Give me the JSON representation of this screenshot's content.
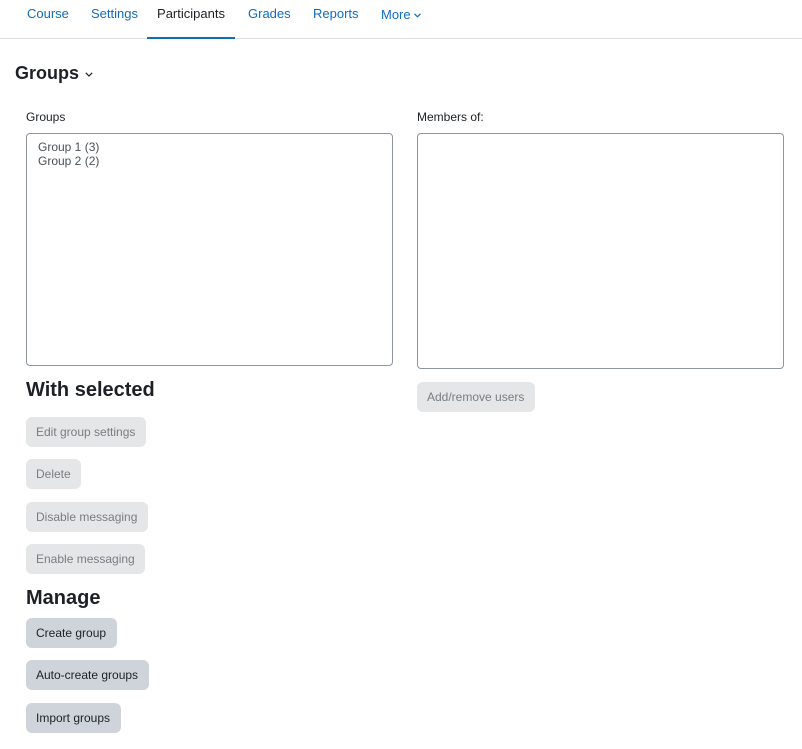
{
  "nav": {
    "tabs": [
      {
        "label": "Course",
        "active": false
      },
      {
        "label": "Settings",
        "active": false
      },
      {
        "label": "Participants",
        "active": true
      },
      {
        "label": "Grades",
        "active": false
      },
      {
        "label": "Reports",
        "active": false
      },
      {
        "label": "More",
        "active": false
      }
    ],
    "more_icon": "chevron-down-icon"
  },
  "page": {
    "title": "Groups",
    "title_icon": "chevron-down-icon"
  },
  "groups_panel": {
    "label": "Groups",
    "options": [
      "Group 1 (3)",
      "Group 2 (2)"
    ]
  },
  "members_panel": {
    "label": "Members of:",
    "options": []
  },
  "with_selected": {
    "heading": "With selected",
    "buttons": {
      "edit_group_settings": "Edit group settings",
      "delete": "Delete",
      "disable_messaging": "Disable messaging",
      "enable_messaging": "Enable messaging"
    }
  },
  "members_actions": {
    "add_remove_users": "Add/remove users"
  },
  "manage": {
    "heading": "Manage",
    "buttons": {
      "create_group": "Create group",
      "auto_create_groups": "Auto-create groups",
      "import_groups": "Import groups"
    }
  },
  "colors": {
    "link": "#0f6cbf",
    "text": "#1d2125",
    "button_disabled_bg": "#e5e6e7",
    "button_enabled_bg": "#ced4da",
    "border": "#8f959e"
  }
}
